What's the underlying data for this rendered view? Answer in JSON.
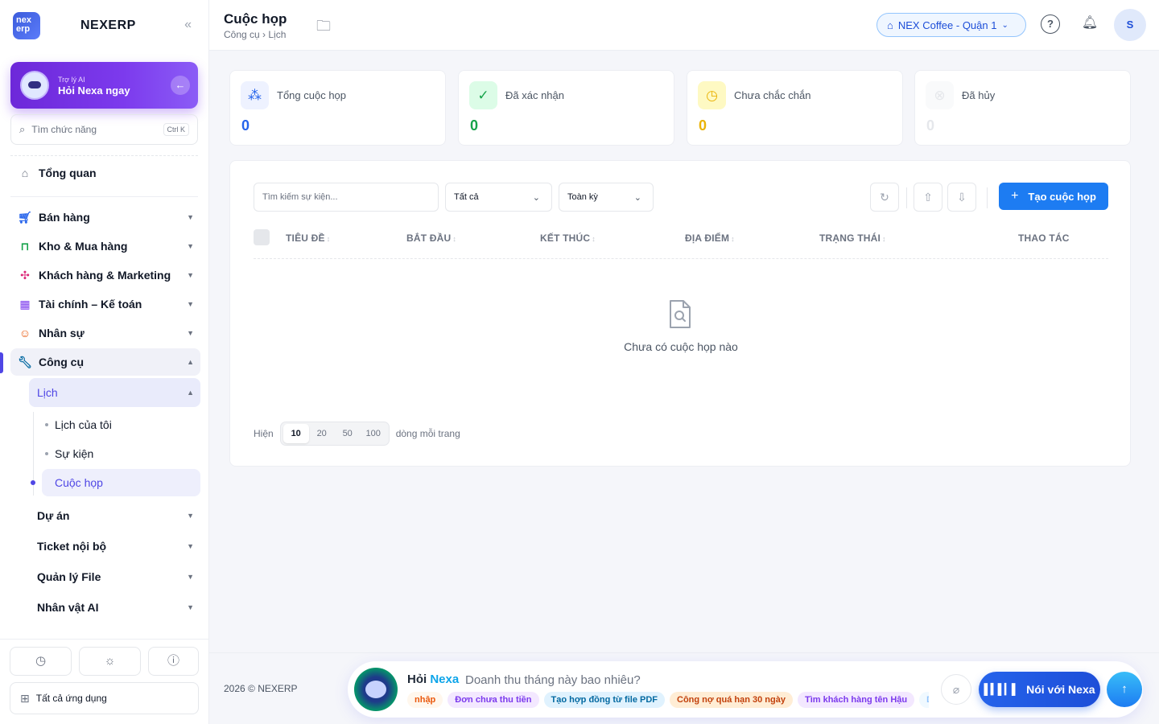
{
  "sidebar": {
    "brand": "NEXERP",
    "logo_text": "nex erp",
    "ai_card": {
      "small": "Trợ lý AI",
      "big": "Hỏi Nexa ngay"
    },
    "search": {
      "placeholder": "Tìm chức năng",
      "shortcut": "Ctrl K"
    },
    "overview": "Tổng quan",
    "menu": [
      {
        "label": "Bán hàng",
        "icon": "cart-icon"
      },
      {
        "label": "Kho & Mua hàng",
        "icon": "bag-icon"
      },
      {
        "label": "Khách hàng & Marketing",
        "icon": "users-icon"
      },
      {
        "label": "Tài chính – Kế toán",
        "icon": "calculator-icon"
      },
      {
        "label": "Nhân sự",
        "icon": "person-icon"
      },
      {
        "label": "Công cụ",
        "icon": "wrench-icon"
      }
    ],
    "tools_sub": {
      "calendar": "Lịch",
      "calendar_items": [
        "Lịch của tôi",
        "Sự kiện",
        "Cuộc họp"
      ],
      "groups": [
        "Dự án",
        "Ticket nội bộ",
        "Quản lý File",
        "Nhân vật AI"
      ]
    },
    "all_apps": "Tất cả ứng dụng"
  },
  "header": {
    "title": "Cuộc họp",
    "breadcrumb": "Công cụ › Lịch",
    "store": "NEX Coffee - Quận 1",
    "avatar_initial": "S"
  },
  "stats": [
    {
      "label": "Tổng cuộc họp",
      "value": "0",
      "color": "#2563eb",
      "icon": "group-icon"
    },
    {
      "label": "Đã xác nhận",
      "value": "0",
      "color": "#16a34a",
      "icon": "check-circle-icon"
    },
    {
      "label": "Chưa chắc chắn",
      "value": "0",
      "color": "#eab308",
      "icon": "clock-icon"
    },
    {
      "label": "Đã hủy",
      "value": "0",
      "color": "#d1d5db",
      "icon": "x-circle-icon"
    }
  ],
  "toolbar": {
    "search_placeholder": "Tìm kiếm sự kiện...",
    "status_filter": "Tất cả",
    "period_filter": "Toàn kỳ",
    "create_label": "Tạo cuộc họp"
  },
  "table": {
    "columns": [
      "TIÊU ĐỀ",
      "BẮT ĐẦU",
      "KẾT THÚC",
      "ĐỊA ĐIỂM",
      "TRẠNG THÁI",
      "THAO TÁC"
    ],
    "empty_text": "Chưa có cuộc họp nào"
  },
  "pagination": {
    "prefix": "Hiện",
    "sizes": [
      "10",
      "20",
      "50",
      "100"
    ],
    "selected": "10",
    "suffix": "dòng mỗi trang"
  },
  "footer": {
    "copyright": "2026 © NEXERP",
    "ask_prefix": "Hỏi",
    "ask_name": "Nexa",
    "ask_placeholder": "Doanh thu tháng này bao nhiêu?",
    "chips": [
      {
        "label": "nhập",
        "color": "#ea580c",
        "bg": "#fff7ed"
      },
      {
        "label": "Đơn chưa thu tiền",
        "color": "#7c3aed",
        "bg": "#f3e8ff"
      },
      {
        "label": "Tạo hợp đồng từ file PDF",
        "color": "#0369a1",
        "bg": "#e0f2fe"
      },
      {
        "label": "Công nợ quá hạn 30 ngày",
        "color": "#c2410c",
        "bg": "#ffedd5"
      },
      {
        "label": "Tìm khách hàng tên Hậu",
        "color": "#7c3aed",
        "bg": "#f3e8ff"
      },
      {
        "label": "Dọ",
        "color": "#93c5fd",
        "bg": "#f0f9ff"
      }
    ],
    "talk_label": "Nói với Nexa"
  }
}
